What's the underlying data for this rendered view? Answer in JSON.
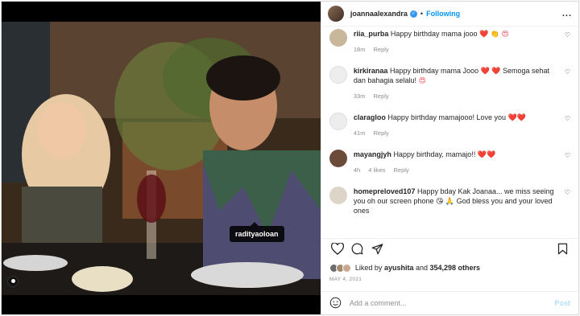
{
  "header": {
    "username": "joannaalexandra",
    "separator": "•",
    "follow_label": "Following",
    "more": "..."
  },
  "media": {
    "tag_label": "radityaoloan"
  },
  "comments": [
    {
      "user": "riia_purba",
      "text": "Happy birthday mama jooo",
      "emoji": "❤️ 👏 😍",
      "time": "18m",
      "reply": "Reply",
      "likes": ""
    },
    {
      "user": "kirkiranaa",
      "text": "Happy birthday mama Jooo",
      "emoji": "❤️ ❤️",
      "text2": "Semoga sehat dan bahagia selalu!",
      "emoji2": "😍",
      "time": "33m",
      "reply": "Reply",
      "likes": ""
    },
    {
      "user": "claragloo",
      "text": "Happy birthday mamajooo! Love you",
      "emoji": "❤️❤️",
      "time": "41m",
      "reply": "Reply",
      "likes": ""
    },
    {
      "user": "mayangjyh",
      "text": "Happy birthday, mamajo!!",
      "emoji": "❤️❤️",
      "time": "4h",
      "reply": "Reply",
      "likes": "4 likes"
    },
    {
      "user": "homepreloved107",
      "text": "Happy bday Kak Joanaa... we miss seeing you oh our screen phone",
      "emoji": "😘 🙏",
      "text2": "God bless you and your loved ones",
      "time": "",
      "reply": "",
      "likes": ""
    }
  ],
  "likes": {
    "prefix": "Liked by",
    "user": "ayushita",
    "and": "and",
    "count": "354,298 others"
  },
  "date": "MAY 4, 2021",
  "add_comment": {
    "placeholder": "Add a comment...",
    "post_label": "Post"
  },
  "colors": {
    "accent": "#0095f6",
    "heart": "#ed4956",
    "verified": "#3897f0"
  }
}
